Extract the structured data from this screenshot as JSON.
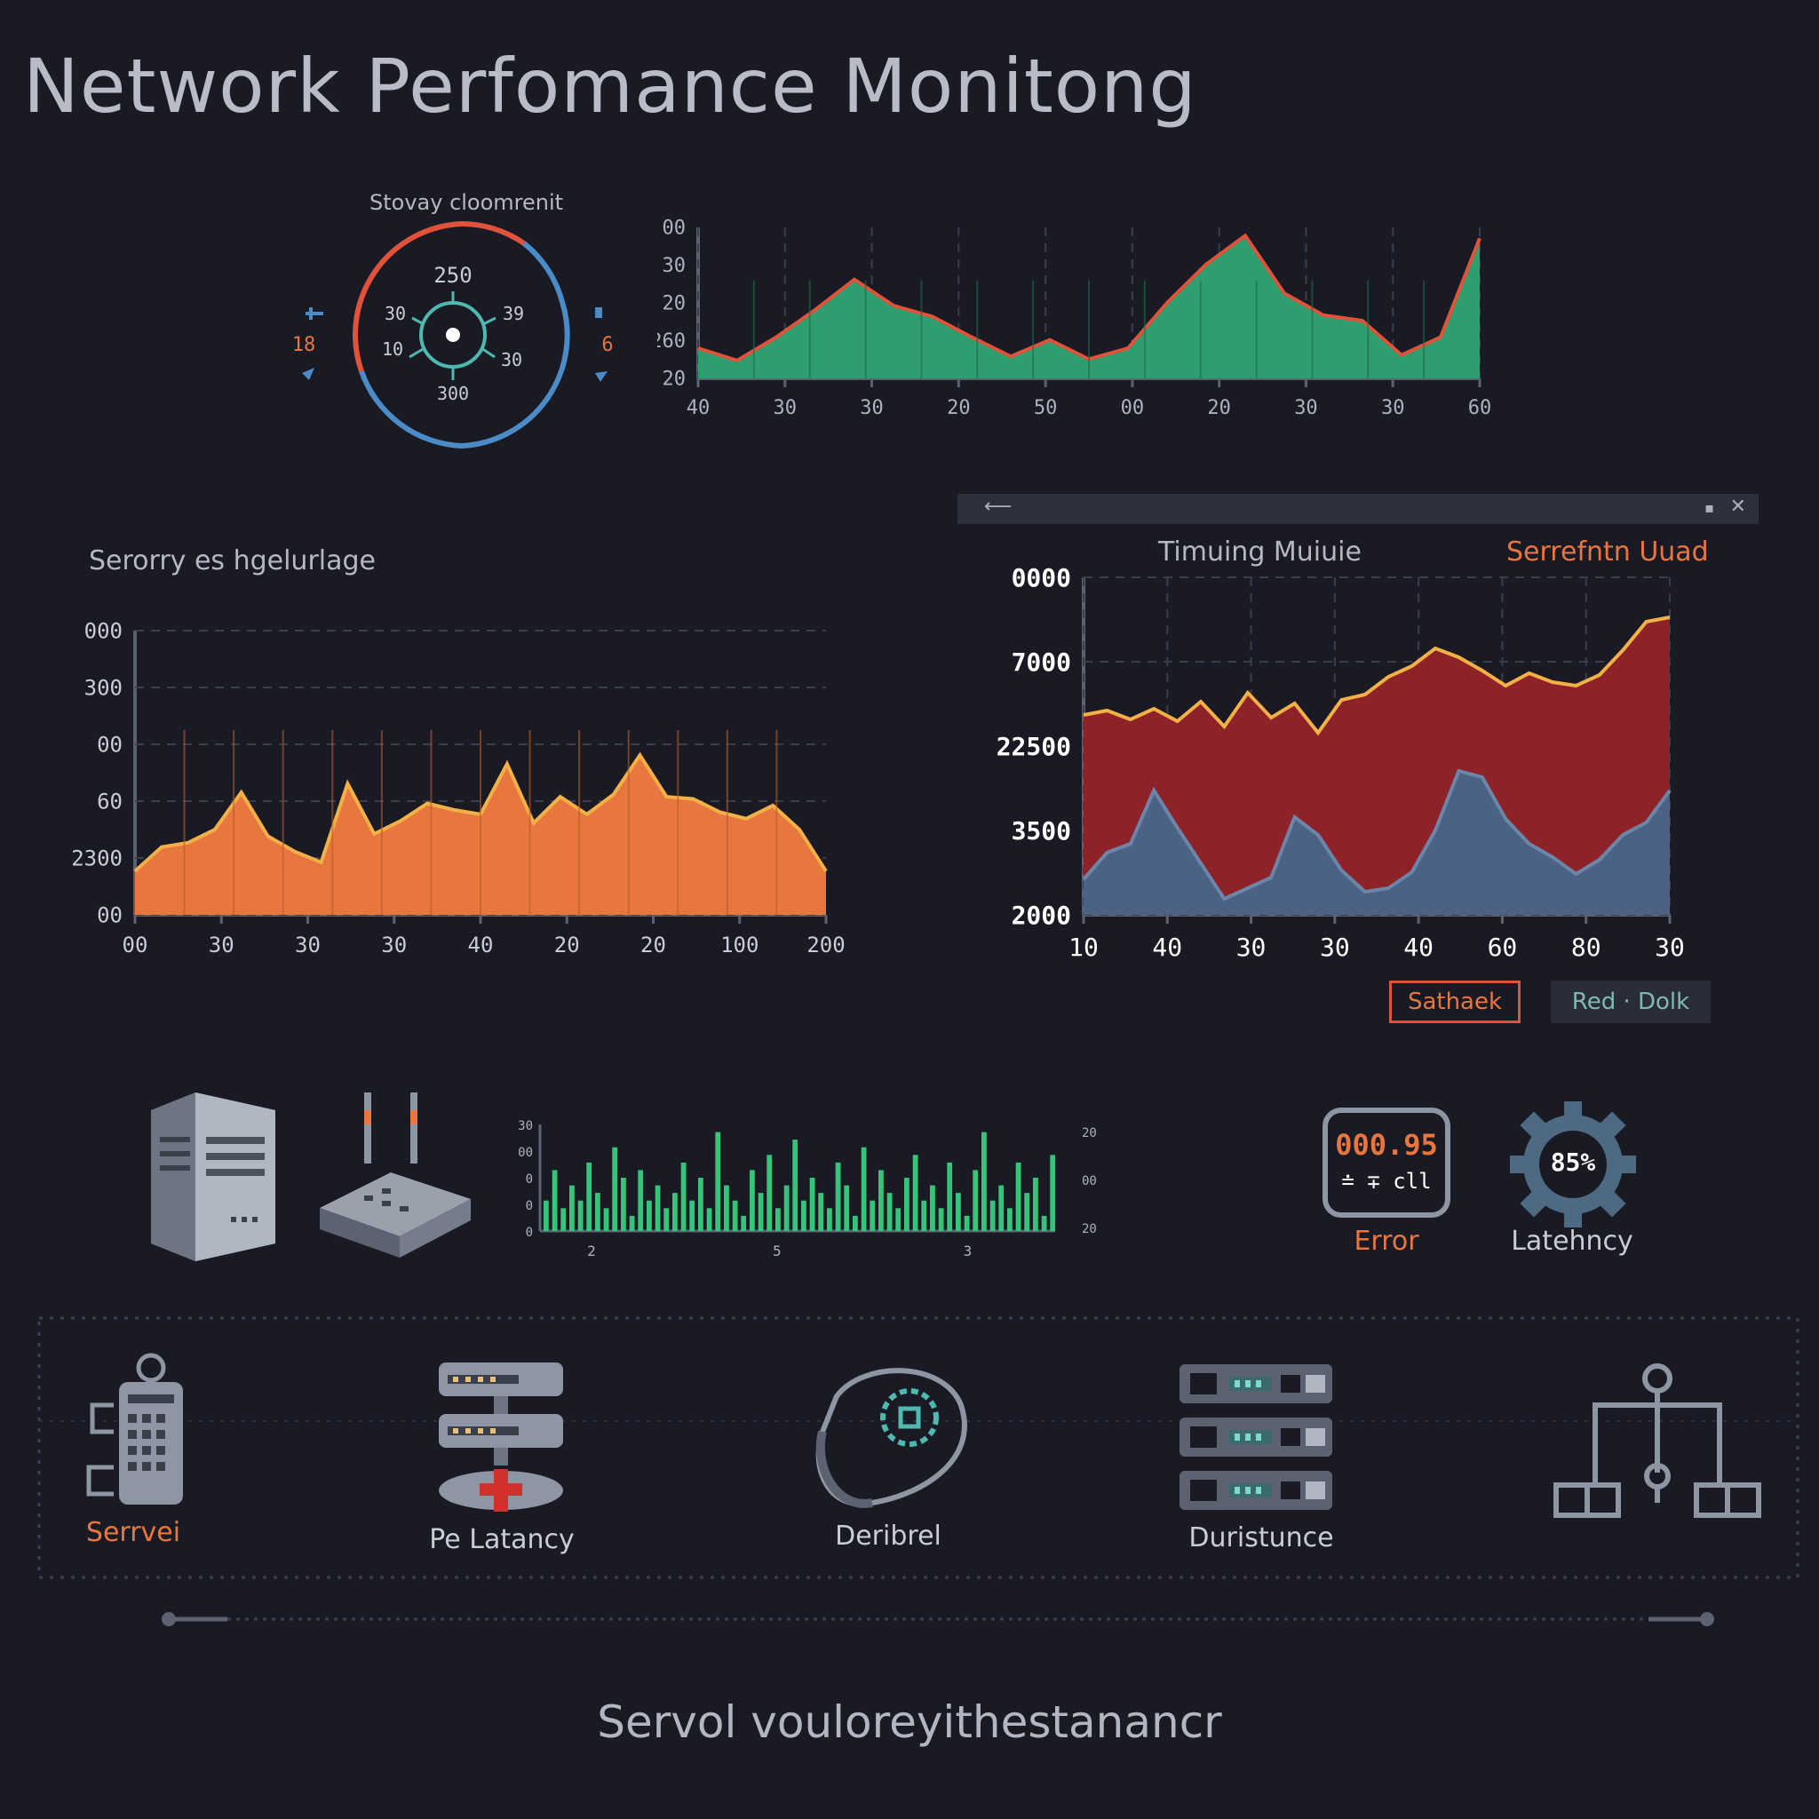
{
  "page": {
    "title": "Network Perfomance Monitong",
    "footer": "Servol vouloreyithestanancr"
  },
  "colors": {
    "background": "#191a24",
    "green": "#2e9e6e",
    "orange": "#e8773f",
    "red": "#8e2229",
    "blue": "#4b6284",
    "gauge_red": "#e0523a",
    "gauge_blue": "#4b8cc8",
    "teal": "#4fb8b0"
  },
  "gauge": {
    "title": "Stovay cloomrenit",
    "center_top": "250",
    "center_bottom": "300",
    "left_upper": "30",
    "left_lower": "10",
    "right_upper": "39",
    "right_lower": "30",
    "outer_left": "18",
    "outer_right": "6"
  },
  "top_chart": {
    "y_ticks": [
      "00",
      "30",
      "20",
      "260",
      "20"
    ],
    "x_ticks": [
      "40",
      "30",
      "30",
      "20",
      "50",
      "00",
      "20",
      "30",
      "30",
      "60"
    ]
  },
  "left_chart": {
    "title": "Serorry es hgelurlage",
    "y_ticks": [
      "000",
      "300",
      "00",
      "60",
      "2300",
      "00"
    ],
    "x_ticks": [
      "00",
      "30",
      "30",
      "30",
      "40",
      "20",
      "20",
      "100",
      "200"
    ]
  },
  "right_chart": {
    "title": "Timuing Muiuie",
    "title_right": "Serrefntn Uuad",
    "y_ticks": [
      "0000",
      "7000",
      "22500",
      "3500",
      "2000"
    ],
    "x_ticks": [
      "10",
      "40",
      "30",
      "30",
      "40",
      "60",
      "80",
      "30"
    ],
    "buttons": [
      "Sathaek",
      "Red · Dolk"
    ]
  },
  "small_chart": {
    "y_ticks_left": [
      "30",
      "00",
      "0",
      "0",
      "0"
    ],
    "y_ticks_right": [
      "20",
      "00",
      "20"
    ],
    "x_ticks": [
      "2",
      "5",
      "3"
    ]
  },
  "metrics": {
    "error_value": "000.95",
    "error_sub": "≐ ∓ cll",
    "error_label": "Error",
    "latency_value": "85%",
    "latency_label": "Latehncy"
  },
  "categories": [
    {
      "label": "Serrvei",
      "icon": "server-tower-icon"
    },
    {
      "label": "Pe Latancy",
      "icon": "server-stack-icon"
    },
    {
      "label": "Deribrel",
      "icon": "target-icon"
    },
    {
      "label": "Duristunce",
      "icon": "rack-icon"
    },
    {
      "label": "",
      "icon": "network-tree-icon"
    }
  ],
  "chart_data": [
    {
      "type": "area",
      "title": "",
      "x": [
        "40",
        "30",
        "30",
        "20",
        "50",
        "00",
        "20",
        "30",
        "30",
        "60"
      ],
      "series": [
        {
          "values": [
            22,
            13,
            30,
            50,
            72,
            53,
            45,
            30,
            16,
            28,
            14,
            22,
            55,
            83,
            104,
            62,
            46,
            42,
            17,
            30,
            102
          ]
        }
      ],
      "ylim": [
        0,
        110
      ]
    },
    {
      "type": "area",
      "title": "Serorry es hgelurlage",
      "x": [
        "00",
        "30",
        "30",
        "30",
        "40",
        "20",
        "20",
        "100",
        "200"
      ],
      "series": [
        {
          "values": [
            40,
            62,
            66,
            78,
            112,
            72,
            58,
            48,
            120,
            74,
            86,
            102,
            96,
            92,
            138,
            84,
            108,
            92,
            110,
            146,
            108,
            106,
            94,
            88,
            100,
            78,
            40
          ]
        }
      ],
      "ylim": [
        0,
        260
      ]
    },
    {
      "type": "area",
      "title": "Timuing Muiuie",
      "x": [
        "10",
        "40",
        "30",
        "30",
        "40",
        "60",
        "80",
        "30"
      ],
      "series": [
        {
          "values": [
            225,
            230,
            220,
            232,
            218,
            240,
            212,
            250,
            222,
            238,
            205,
            242,
            248,
            268,
            280,
            300,
            290,
            275,
            258,
            272,
            262,
            258,
            270,
            298,
            330,
            335
          ]
        },
        {
          "values": [
            40,
            70,
            80,
            140,
            98,
            58,
            18,
            30,
            42,
            110,
            90,
            50,
            26,
            30,
            48,
            95,
            162,
            155,
            108,
            80,
            65,
            46,
            62,
            90,
            104,
            140
          ]
        }
      ],
      "ylim": [
        0,
        380
      ]
    },
    {
      "type": "bar",
      "x": [
        "2",
        "5",
        "3"
      ],
      "series": [
        {
          "values": [
            4,
            8,
            3,
            6,
            4,
            9,
            5,
            3,
            11,
            7,
            2,
            8,
            4,
            6,
            3,
            5,
            9,
            4,
            7,
            3,
            13,
            6,
            4,
            2,
            8,
            5,
            10,
            3,
            6,
            12,
            4,
            7,
            5,
            3,
            9,
            6,
            2,
            11,
            4,
            8,
            5,
            3,
            7,
            10,
            4,
            6,
            3,
            9,
            5,
            2,
            8,
            13,
            4,
            6,
            3,
            9,
            5,
            7,
            2,
            10
          ]
        }
      ],
      "ylim": [
        0,
        14
      ]
    }
  ]
}
